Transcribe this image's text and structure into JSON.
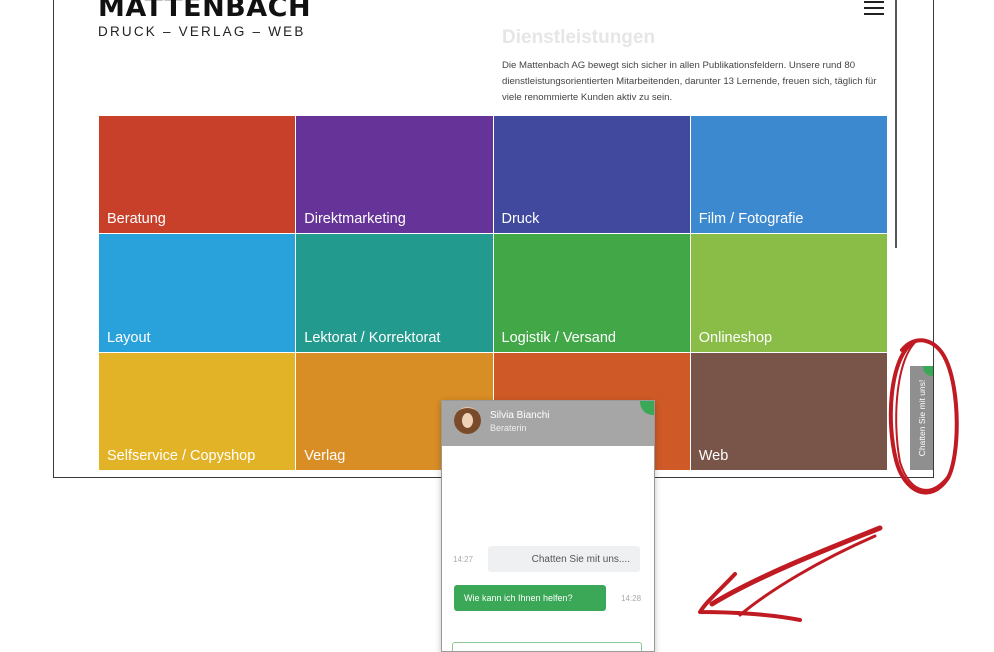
{
  "logo": {
    "title": "MATTENBACH",
    "subtitle": "DRUCK – VERLAG – WEB"
  },
  "section": {
    "title": "Dienstleistungen",
    "text": "Die Mattenbach AG bewegt sich sicher in allen Publikationsfeldern. Unsere rund 80 dienstleistungsorientierten Mitarbeitenden, darunter 13 Lernende, freuen sich, täglich für viele renommierte Kunden aktiv zu sein."
  },
  "tiles": [
    {
      "label": "Beratung",
      "color": "#c9402a"
    },
    {
      "label": "Direktmarketing",
      "color": "#663399"
    },
    {
      "label": "Druck",
      "color": "#40499e"
    },
    {
      "label": "Film / Fotografie",
      "color": "#3d89cf"
    },
    {
      "label": "Layout",
      "color": "#29a2dc"
    },
    {
      "label": "Lektorat / Korrektorat",
      "color": "#229a8d"
    },
    {
      "label": "Logistik / Versand",
      "color": "#42a746"
    },
    {
      "label": "Onlineshop",
      "color": "#89bd48"
    },
    {
      "label": "Selfservice / Copyshop",
      "color": "#e2b326"
    },
    {
      "label": "Verlag",
      "color": "#d98d25"
    },
    {
      "label": "",
      "color": "#cf5a27"
    },
    {
      "label": "Web",
      "color": "#785548"
    }
  ],
  "chat": {
    "agent_name": "Silvia Bianchi",
    "agent_role": "Beraterin",
    "messages": [
      {
        "time": "14:27",
        "text": "Chatten Sie mit uns...."
      },
      {
        "time": "14:28",
        "text": "Wie kann ich Ihnen helfen?"
      }
    ]
  },
  "side_tab": {
    "label": "Chatten Sie mit uns!"
  },
  "colors": {
    "chat_green": "#3aa856",
    "annotation_red": "#c01a22"
  }
}
